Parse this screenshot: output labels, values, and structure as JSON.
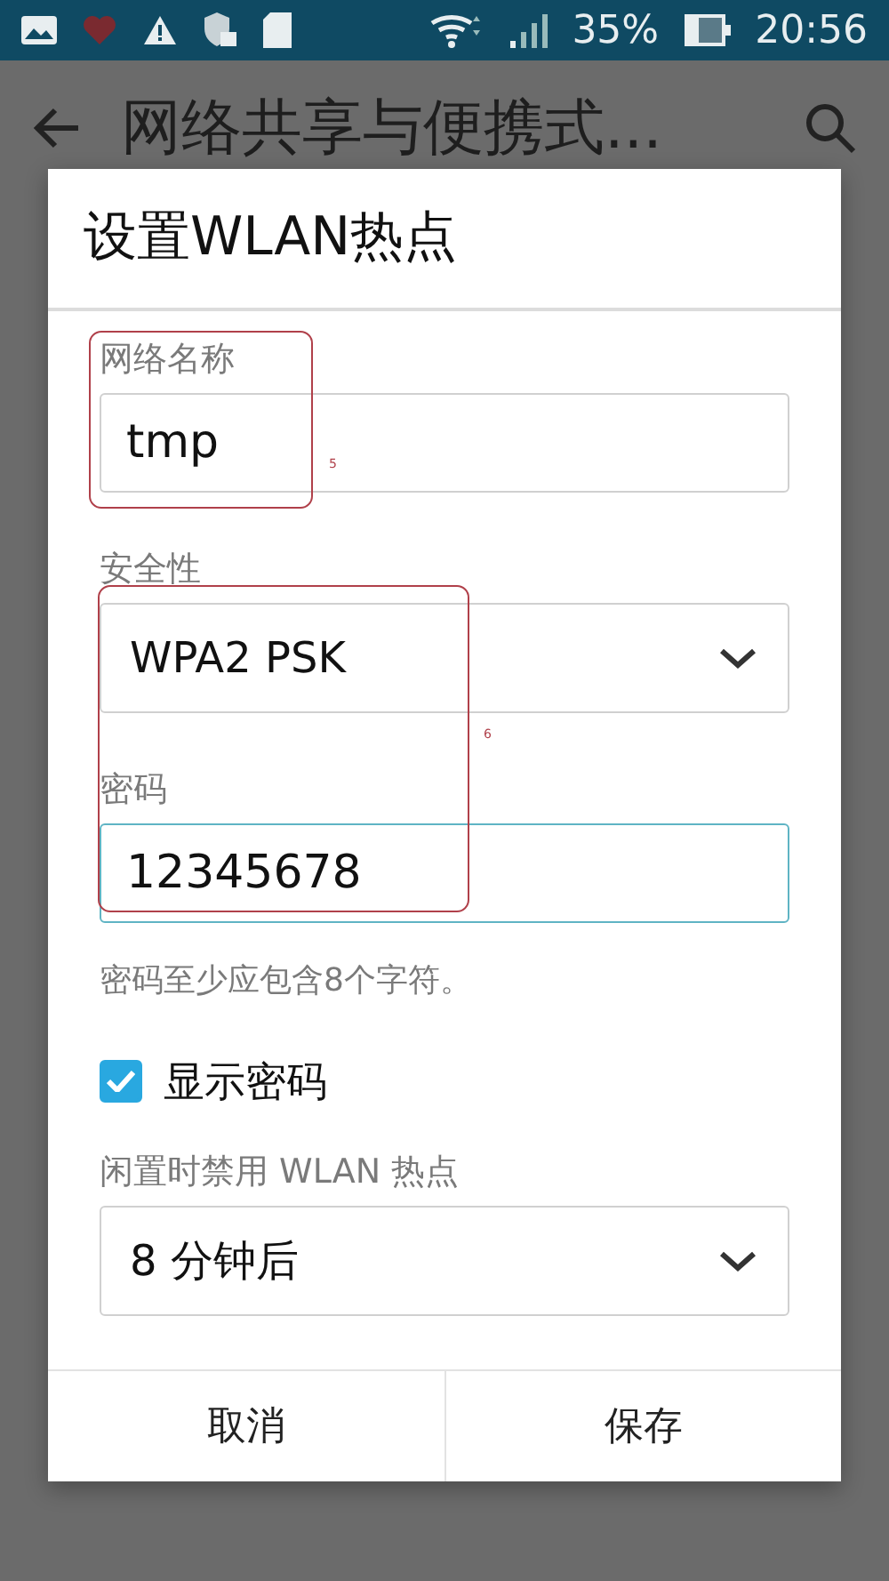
{
  "status_bar": {
    "battery": "35%",
    "time": "20:56"
  },
  "app_bar": {
    "title": "网络共享与便携式..."
  },
  "dialog": {
    "title": "设置WLAN热点",
    "network_name": {
      "label": "网络名称",
      "value": "tmp"
    },
    "security": {
      "label": "安全性",
      "value": "WPA2 PSK"
    },
    "password": {
      "label": "密码",
      "value": "12345678",
      "focused": true,
      "hint": "密码至少应包含8个字符。"
    },
    "show_password": {
      "label": "显示密码",
      "checked": true
    },
    "idle": {
      "label": "闲置时禁用 WLAN 热点",
      "value": "8 分钟后"
    },
    "buttons": [
      "取消",
      "保存"
    ]
  },
  "annotations": [
    {
      "label": "5"
    },
    {
      "label": "6"
    }
  ]
}
